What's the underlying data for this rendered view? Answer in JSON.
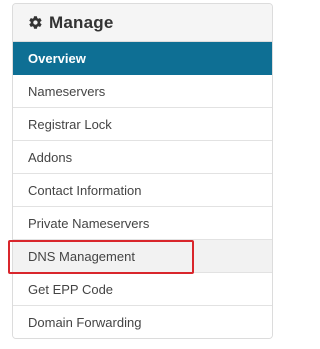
{
  "panel": {
    "title": "Manage",
    "icon": "gear-icon"
  },
  "menu": {
    "items": [
      {
        "label": "Overview",
        "active": true
      },
      {
        "label": "Nameservers",
        "active": false
      },
      {
        "label": "Registrar Lock",
        "active": false
      },
      {
        "label": "Addons",
        "active": false
      },
      {
        "label": "Contact Information",
        "active": false
      },
      {
        "label": "Private Nameservers",
        "active": false
      },
      {
        "label": "DNS Management",
        "active": false,
        "highlighted": true
      },
      {
        "label": "Get EPP Code",
        "active": false
      },
      {
        "label": "Domain Forwarding",
        "active": false
      }
    ]
  },
  "colors": {
    "active_bg": "#0e6f94",
    "highlight_border": "#d9262c",
    "header_bg": "#f5f5f5"
  }
}
